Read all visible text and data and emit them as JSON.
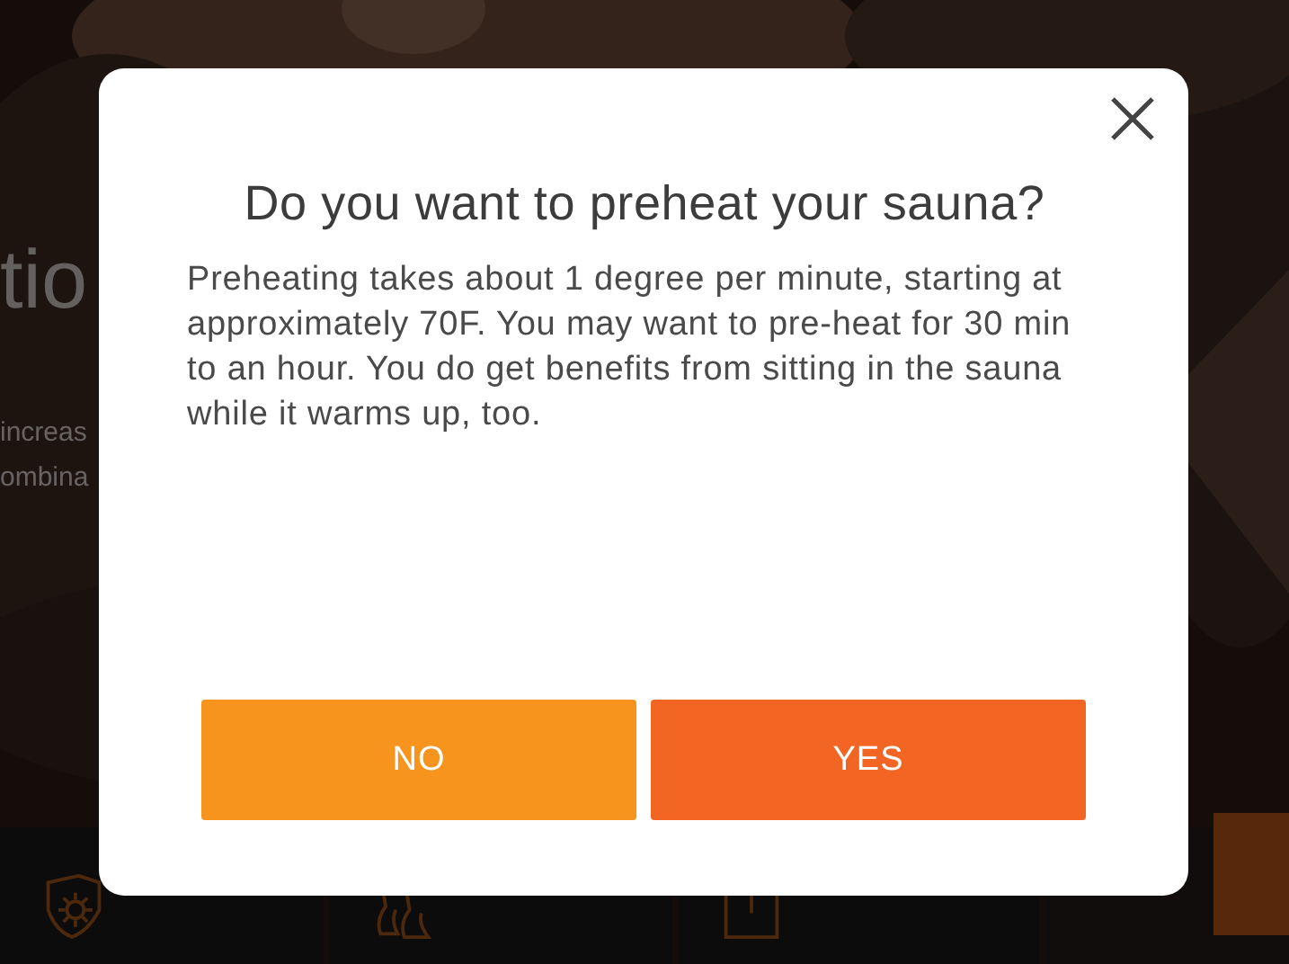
{
  "background": {
    "heading": "tio",
    "lines": [
      "increas",
      "ombina"
    ],
    "tiles": [
      {
        "kind": "shield"
      },
      {
        "kind": "feet"
      },
      {
        "kind": "scale"
      }
    ]
  },
  "dialog": {
    "title": "Do you want to preheat your sauna?",
    "message": "Preheating takes about 1 degree per minute, starting at approximately 70F. You may want to pre-heat for 30 min to an hour. You do get benefits from sitting in the sauna while it warms up, too.",
    "buttons": [
      {
        "label": "NO",
        "kind": "secondary"
      },
      {
        "label": "YES",
        "kind": "primary"
      }
    ]
  }
}
